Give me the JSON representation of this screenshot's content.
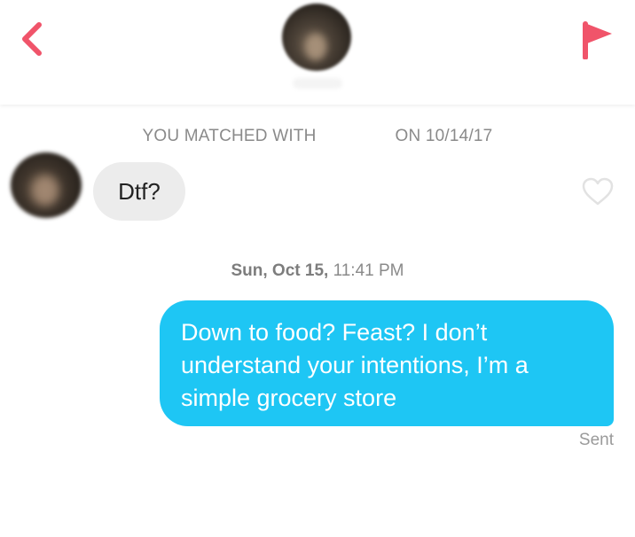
{
  "colors": {
    "accent": "#f0546a",
    "outgoing_bubble": "#1ec6f4",
    "incoming_bubble": "#ececec",
    "meta_text": "#8a8a8a"
  },
  "header": {
    "back_icon": "chevron-left-icon",
    "flag_icon": "flag-icon"
  },
  "match_info": {
    "prefix": "YOU MATCHED WITH",
    "suffix": "ON 10/14/17"
  },
  "messages": {
    "incoming": {
      "text": "Dtf?",
      "like_icon": "heart-outline-icon"
    },
    "timestamp": {
      "day": "Sun, Oct 15,",
      "time": "11:41 PM"
    },
    "outgoing": {
      "text": "Down to food? Feast? I don’t understand your intentions, I’m a simple grocery store",
      "status": "Sent"
    }
  }
}
